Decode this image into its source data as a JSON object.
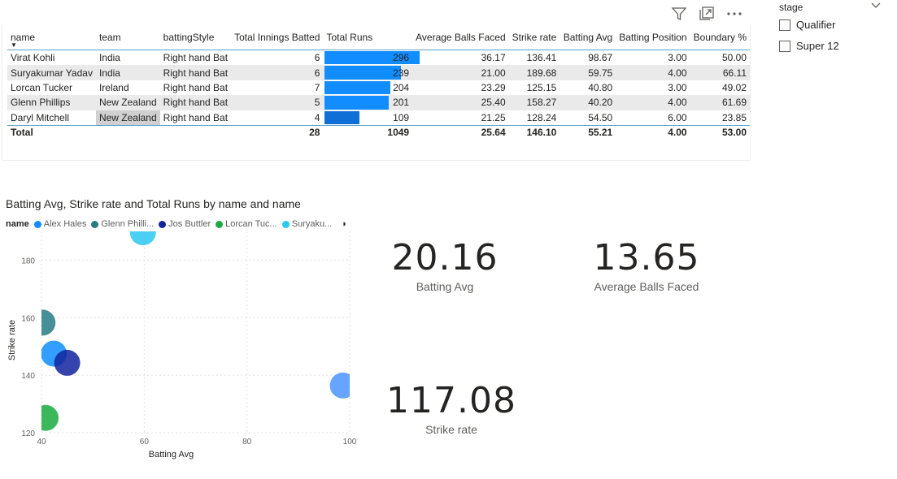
{
  "header_icons": [
    "filter-icon",
    "focus-mode-icon",
    "more-options-icon"
  ],
  "table": {
    "columns": [
      "name",
      "team",
      "battingStyle",
      "Total Innings Batted",
      "Total Runs",
      "Average Balls Faced",
      "Strike rate",
      "Batting Avg",
      "Batting Position",
      "Boundary %"
    ],
    "rows": [
      {
        "name": "Virat Kohli",
        "team": "India",
        "style": "Right hand Bat",
        "innings": "6",
        "runs": "296",
        "runs_value": 296,
        "balls": "36.17",
        "sr": "136.41",
        "avg": "98.67",
        "pos": "3.00",
        "boundary": "50.00"
      },
      {
        "name": "Suryakumar Yadav",
        "team": "India",
        "style": "Right hand Bat",
        "innings": "6",
        "runs": "239",
        "runs_value": 239,
        "balls": "21.00",
        "sr": "189.68",
        "avg": "59.75",
        "pos": "4.00",
        "boundary": "66.11"
      },
      {
        "name": "Lorcan Tucker",
        "team": "Ireland",
        "style": "Right hand Bat",
        "innings": "7",
        "runs": "204",
        "runs_value": 204,
        "balls": "23.29",
        "sr": "125.15",
        "avg": "40.80",
        "pos": "3.00",
        "boundary": "49.02"
      },
      {
        "name": "Glenn Phillips",
        "team": "New Zealand",
        "style": "Right hand Bat",
        "innings": "5",
        "runs": "201",
        "runs_value": 201,
        "balls": "25.40",
        "sr": "158.27",
        "avg": "40.20",
        "pos": "4.00",
        "boundary": "61.69"
      },
      {
        "name": "Daryl Mitchell",
        "team": "New Zealand",
        "style": "Right hand Bat",
        "innings": "4",
        "runs": "109",
        "runs_value": 109,
        "balls": "21.25",
        "sr": "128.24",
        "avg": "54.50",
        "pos": "6.00",
        "boundary": "23.85"
      }
    ],
    "total": {
      "label": "Total",
      "innings": "28",
      "runs": "1049",
      "balls": "25.64",
      "sr": "146.10",
      "avg": "55.21",
      "pos": "4.00",
      "boundary": "53.00"
    },
    "runs_max": 296,
    "bar_color": "#118dff"
  },
  "slicer": {
    "title": "stage",
    "options": [
      "Qualifier",
      "Super 12"
    ]
  },
  "chart_data": {
    "type": "scatter",
    "title": "Batting Avg, Strike rate and Total Runs by name and name",
    "legend_title": "name",
    "legend": [
      {
        "name": "Alex Hales",
        "color": "#118dff"
      },
      {
        "name": "Glenn Philli...",
        "color": "#267c84"
      },
      {
        "name": "Jos Buttler",
        "color": "#12239e"
      },
      {
        "name": "Lorcan Tuc...",
        "color": "#1aab40"
      },
      {
        "name": "Suryaku...",
        "color": "#2cc7f0"
      }
    ],
    "xlabel": "Batting Avg",
    "ylabel": "Strike rate",
    "xlim": [
      40,
      100
    ],
    "ylim": [
      120,
      190
    ],
    "xticks": [
      "40",
      "60",
      "80",
      "100"
    ],
    "yticks": [
      "120",
      "140",
      "160",
      "180"
    ],
    "grid": true,
    "points": [
      {
        "name": "Suryakumar Yadav",
        "x": 59.75,
        "y": 189.68,
        "color": "#2cc7f0"
      },
      {
        "name": "Glenn Phillips",
        "x": 40.2,
        "y": 158.27,
        "color": "#267c84"
      },
      {
        "name": "Alex Hales",
        "x": 42.4,
        "y": 147.5,
        "color": "#118dff"
      },
      {
        "name": "Jos Buttler",
        "x": 45.0,
        "y": 144.3,
        "color": "#12239e"
      },
      {
        "name": "Virat Kohli",
        "x": 98.67,
        "y": 136.41,
        "color": "#4a95ff"
      },
      {
        "name": "Lorcan Tucker",
        "x": 40.8,
        "y": 125.15,
        "color": "#1aab40"
      }
    ]
  },
  "cards": [
    {
      "value": "20.16",
      "label": "Batting Avg"
    },
    {
      "value": "13.65",
      "label": "Average Balls Faced"
    },
    {
      "value": "117.08",
      "label": "Strike rate"
    }
  ]
}
